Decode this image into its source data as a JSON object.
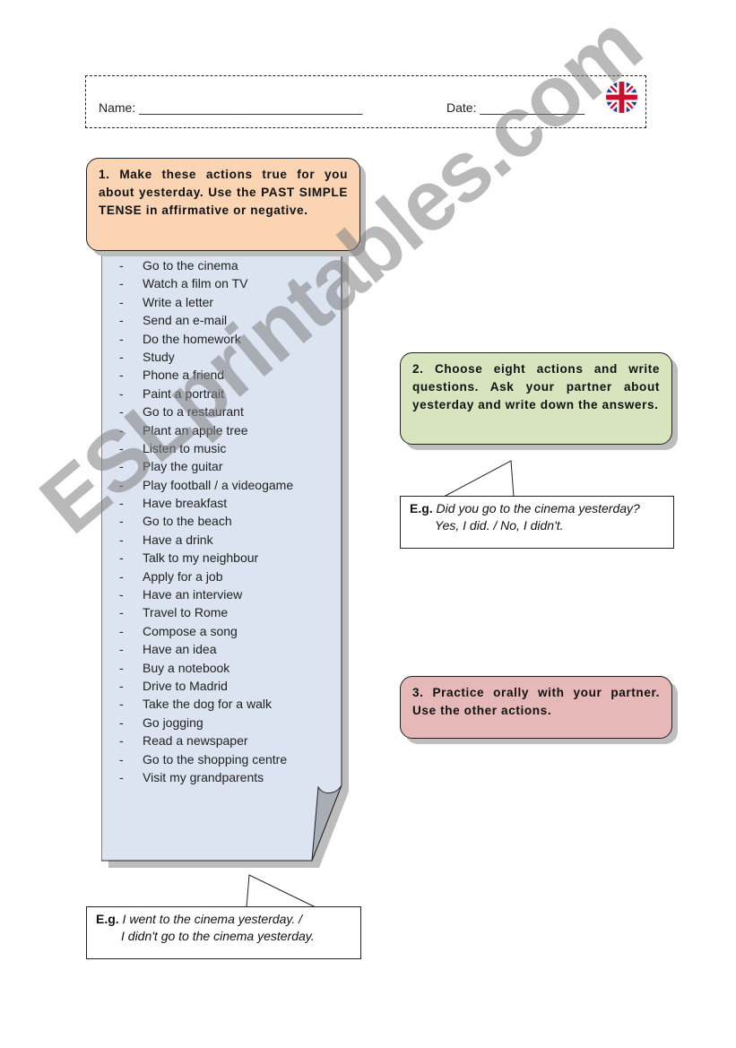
{
  "header": {
    "name_label": "Name: ________________________________",
    "date_label": "Date: _______________",
    "flag_icon": "uk-flag-icon"
  },
  "task1": {
    "text": "1. Make these actions true for you about yesterday. Use the PAST SIMPLE TENSE in affirmative or negative.",
    "color": "#fbd4b4"
  },
  "actions": {
    "bullet": "-",
    "items": [
      "Go to the cinema",
      "Watch a film on TV",
      "Write a letter",
      "Send an e-mail",
      "Do the homework",
      "Study",
      "Phone a friend",
      "Paint a portrait",
      "Go to a restaurant",
      "Plant an apple tree",
      "Listen to music",
      "Play the guitar",
      "Play football / a videogame",
      "Have breakfast",
      "Go to the beach",
      "Have a drink",
      "Talk to my neighbour",
      "Apply for a job",
      "Have an interview",
      "Travel to Rome",
      "Compose a song",
      "Have an idea",
      "Buy a notebook",
      "Drive to Madrid",
      "Take the dog for a walk",
      "Go jogging",
      "Read a newspaper",
      "Go to the shopping centre",
      "Visit my grandparents"
    ],
    "color": "#dce3f1"
  },
  "example1": {
    "label": "E.g.",
    "line1": " I went to the cinema yesterday. /",
    "line2": "I didn't go to the cinema yesterday."
  },
  "task2": {
    "text": "2. Choose eight actions and write questions. Ask your partner about yesterday and write down the answers.",
    "color": "#d7e4bd"
  },
  "example2": {
    "label": "E.g.",
    "line1": " Did you go to the cinema yesterday?",
    "line2": "Yes, I did. / No, I didn't."
  },
  "task3": {
    "text": "3. Practice orally with your partner. Use the other actions.",
    "color": "#e6b9b8"
  },
  "watermark": "ESLprintables.com"
}
